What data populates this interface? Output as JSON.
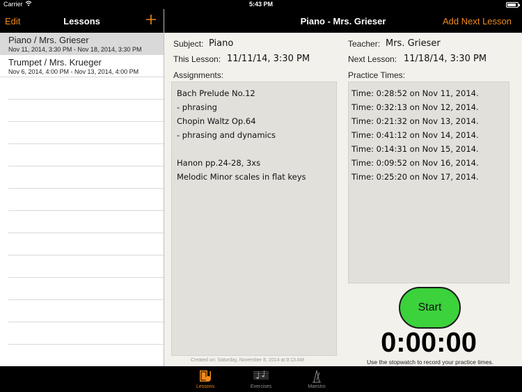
{
  "status_bar": {
    "carrier": "Carrier",
    "time": "5:43 PM",
    "battery_level": 0.85
  },
  "left_nav": {
    "edit_label": "Edit",
    "title": "Lessons",
    "add_icon": "plus-icon"
  },
  "lessons": [
    {
      "title": "Piano / Mrs. Grieser",
      "dates": "Nov 11, 2014, 3:30 PM - Nov 18, 2014, 3:30 PM",
      "selected": true
    },
    {
      "title": "Trumpet / Mrs. Krueger",
      "dates": "Nov 6, 2014, 4:00 PM - Nov 13, 2014, 4:00 PM",
      "selected": false
    }
  ],
  "right_nav": {
    "title": "Piano - Mrs. Grieser",
    "add_next_label": "Add Next Lesson"
  },
  "lesson_detail": {
    "subject_label": "Subject:",
    "subject_value": "Piano",
    "teacher_label": "Teacher:",
    "teacher_value": "Mrs. Grieser",
    "this_lesson_label": "This Lesson:",
    "this_lesson_value": "11/11/14, 3:30 PM",
    "next_lesson_label": "Next Lesson:",
    "next_lesson_value": "11/18/14, 3:30 PM",
    "assignments_label": "Assignments:",
    "assignments": [
      "Bach Prelude No.12",
      "- phrasing",
      "Chopin Waltz Op.64",
      "- phrasing and dynamics",
      "",
      "Hanon pp.24-28, 3xs",
      "Melodic Minor scales in flat keys"
    ],
    "practice_label": "Practice Times:",
    "practice_times": [
      "Time: 0:28:52 on Nov 11, 2014.",
      "Time: 0:32:13 on Nov 12, 2014.",
      "Time: 0:21:32 on Nov 13, 2014.",
      "Time: 0:41:12 on Nov 14, 2014.",
      "Time: 0:14:31 on Nov 15, 2014.",
      "Time: 0:09:52 on Nov 16, 2014.",
      "Time: 0:25:20 on Nov 17, 2014."
    ],
    "created_on": "Created on: Saturday, November 8, 2014 at 9:13 AM"
  },
  "stopwatch": {
    "start_label": "Start",
    "time": "0:00:00",
    "hint": "Use the stopwatch to record your practice times."
  },
  "tabs": [
    {
      "label": "Lessons",
      "icon": "music-book-icon",
      "active": true
    },
    {
      "label": "Exercises",
      "icon": "sheet-music-icon",
      "active": false
    },
    {
      "label": "Maestro",
      "icon": "metronome-icon",
      "active": false
    }
  ],
  "colors": {
    "accent": "#f08a1c",
    "start_button": "#3bd23b",
    "nav_bar": "#000000"
  }
}
